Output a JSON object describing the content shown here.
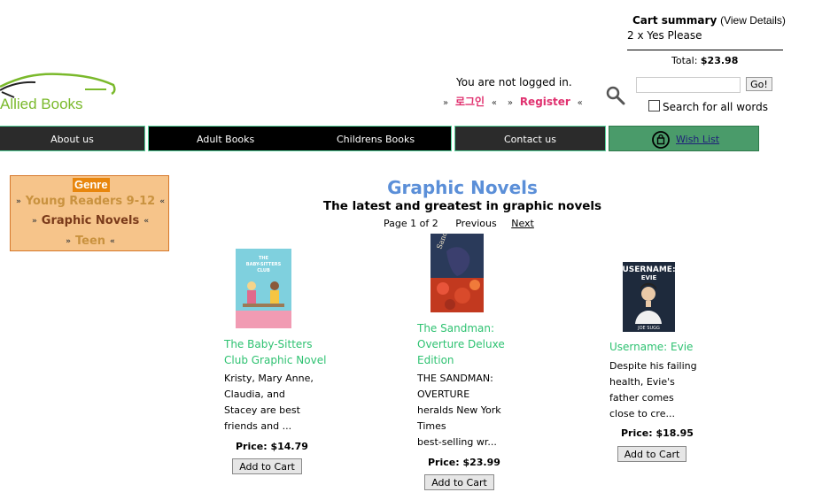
{
  "cart": {
    "title": "Cart summary",
    "view_details": "(View Details)",
    "line": "2 x Yes Please",
    "total_label": "Total:",
    "total_value": "$23.98"
  },
  "logo": {
    "text": "Allied Books"
  },
  "login": {
    "message": "You are not logged in.",
    "login_link": "로그인",
    "register_link": "Register",
    "open_quote": "»",
    "close_quote": "«"
  },
  "search": {
    "input_value": "",
    "go_label": "Go!",
    "all_words_label": "Search for all words"
  },
  "nav": {
    "about": "About us",
    "adult": "Adult Books",
    "childrens": "Childrens Books",
    "contact": "Contact us",
    "wishlist": "Wish List"
  },
  "genre": {
    "heading": "Genre",
    "items": [
      "Young Readers 9-12",
      "Graphic Novels",
      "Teen"
    ],
    "open_quote": "»",
    "close_quote": "«"
  },
  "main": {
    "title": "Graphic Novels",
    "subtitle": "The latest and greatest in graphic novels",
    "pager_text": "Page 1 of 2",
    "previous": "Previous",
    "next": "Next"
  },
  "products": [
    {
      "title_lines": [
        "The Baby-Sitters",
        "Club Graphic Novel"
      ],
      "desc_lines": [
        "Kristy, Mary Anne,",
        "Claudia, and",
        "Stacey are best",
        "friends and ..."
      ],
      "price": "Price: $14.79",
      "button": "Add to Cart",
      "cover_text": [
        "THE",
        "BABY-SITTERS",
        "CLUB"
      ]
    },
    {
      "title_lines": [
        "The Sandman:",
        "Overture Deluxe",
        "Edition"
      ],
      "desc_lines": [
        "THE SANDMAN:",
        "OVERTURE",
        "heralds New York",
        "Times",
        "best-selling wr..."
      ],
      "price": "Price: $23.99",
      "button": "Add to Cart",
      "cover_text": [
        "Sandman"
      ]
    },
    {
      "title_lines": [
        "Username: Evie"
      ],
      "desc_lines": [
        "Despite his failing",
        "health, Evie's",
        "father comes",
        "close to cre..."
      ],
      "price": "Price: $18.95",
      "button": "Add to Cart",
      "cover_text": [
        "USERNAME:",
        "EVIE",
        "JOE SUGG"
      ]
    }
  ],
  "colors": {
    "title_blue": "#5b8fd8",
    "product_green": "#2ec271",
    "nav_dark": "#2b2b2b",
    "wishlist_green": "#4a9b6a",
    "genre_bg": "#f6c48a",
    "link_pink": "#e0316f"
  }
}
